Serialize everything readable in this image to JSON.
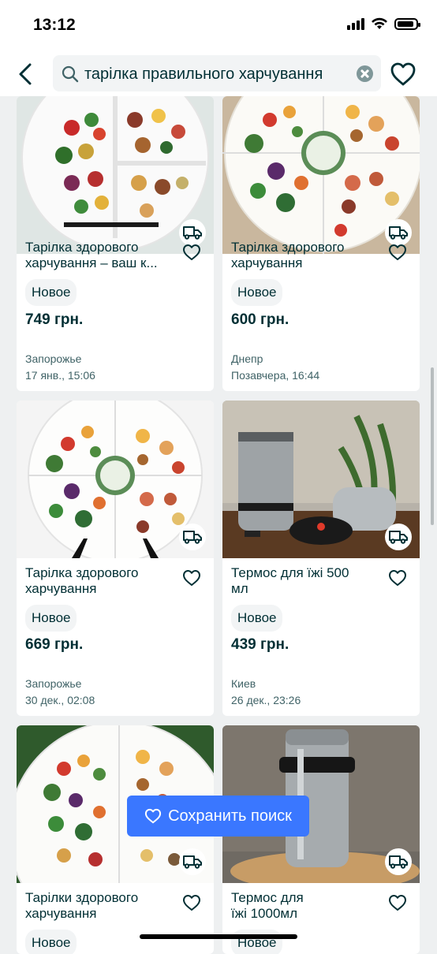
{
  "status_bar": {
    "time": "13:12"
  },
  "search": {
    "query": "тарілка правильного харчування"
  },
  "save_search": {
    "label": "Сохранить поиск"
  },
  "listings": [
    {
      "title": "Тарілка здорового харчування – ваш к...",
      "condition": "Новое",
      "price": "749 грн.",
      "location": "Запорожье",
      "date": "17 янв., 15:06"
    },
    {
      "title": "Тарілка здорового харчування",
      "condition": "Новое",
      "price": "600 грн.",
      "location": "Днепр",
      "date": "Позавчера, 16:44"
    },
    {
      "title": "Тарілка здорового харчування",
      "condition": "Новое",
      "price": "669 грн.",
      "location": "Запорожье",
      "date": "30 дек., 02:08"
    },
    {
      "title": "Термос для їжі 500 мл",
      "condition": "Новое",
      "price": "439 грн.",
      "location": "Киев",
      "date": "26 дек., 23:26"
    },
    {
      "title": "Тарілки здорового харчування",
      "condition": "Новое"
    },
    {
      "title": "Термос для їжі 1000мл",
      "condition": "Новое"
    }
  ],
  "colors": {
    "accent": "#3a77ff",
    "text": "#002f34"
  }
}
